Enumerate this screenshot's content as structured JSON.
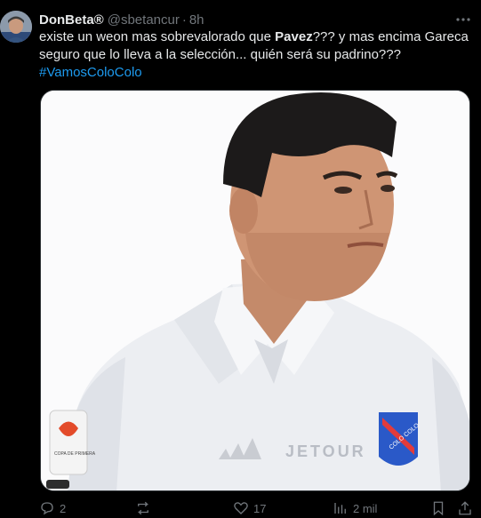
{
  "author": {
    "display_name": "DonBeta®",
    "handle": "@sbetancur",
    "time": "8h"
  },
  "tweet": {
    "text_before_bold": "existe un weon mas sobrevalorado que ",
    "bold_word": "Pavez",
    "text_after_bold": "??? y mas encima Gareca seguro que lo lleva a la selección... quién será su padrino???",
    "hashtag": "#VamosColoColo"
  },
  "media": {
    "shirt_sponsor": "JETOUR",
    "badge_text": "COLO COLO",
    "patch_text": "COPA DE PRIMERA"
  },
  "actions": {
    "replies": "2",
    "reposts": "",
    "likes": "17",
    "views": "2 mil"
  },
  "colors": {
    "background": "#000000",
    "text": "#e7e9ea",
    "muted": "#71767b",
    "link": "#1d9bf0"
  },
  "icons": [
    "more-icon",
    "reply-icon",
    "repost-icon",
    "like-icon",
    "views-icon",
    "bookmark-icon",
    "share-icon"
  ]
}
